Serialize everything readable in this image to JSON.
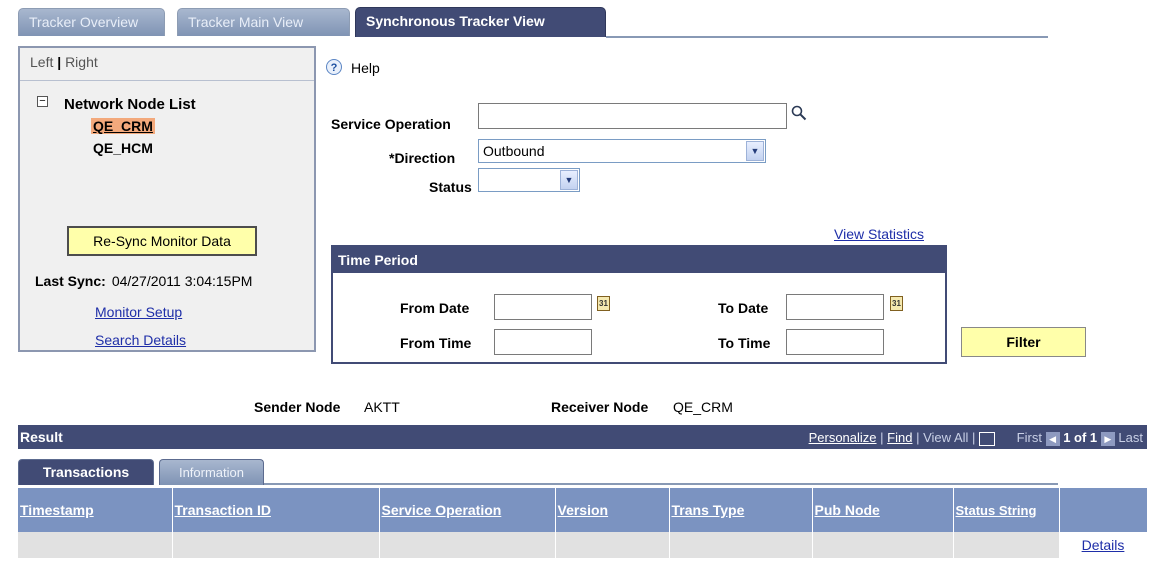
{
  "tabs": [
    "Tracker Overview",
    "Tracker Main View",
    "Synchronous Tracker View"
  ],
  "left_pane": {
    "toggle_left": "Left",
    "toggle_sep": "|",
    "toggle_right": "Right",
    "tree_toggle": "−",
    "tree_title": "Network Node List",
    "nodes": [
      "QE_CRM",
      "QE_HCM"
    ],
    "resync_label": "Re-Sync Monitor Data",
    "last_sync_label": "Last Sync:",
    "last_sync_value": "04/27/2011  3:04:15PM",
    "monitor_setup": "Monitor Setup",
    "search_details": "Search Details"
  },
  "help": {
    "icon_glyph": "?",
    "label": "Help"
  },
  "form": {
    "service_operation_label": "Service Operation",
    "service_operation_value": "",
    "direction_label": "*Direction",
    "direction_value": "Outbound",
    "status_label": "Status",
    "status_value": "",
    "view_statistics": "View Statistics"
  },
  "time_period": {
    "title": "Time Period",
    "from_date_label": "From Date",
    "to_date_label": "To Date",
    "from_time_label": "From Time",
    "to_time_label": "To Time",
    "calendar_glyph": "31"
  },
  "filter_label": "Filter",
  "nodes_info": {
    "sender_label": "Sender Node",
    "sender_value": "AKTT",
    "receiver_label": "Receiver Node",
    "receiver_value": "QE_CRM"
  },
  "result": {
    "title": "Result",
    "personalize": "Personalize",
    "find": "Find",
    "view_all": "View All",
    "first": "First",
    "page_info": "1 of 1",
    "last": "Last",
    "tabs": [
      "Transactions",
      "Information"
    ],
    "columns": [
      "Timestamp",
      "Transaction ID",
      "Service Operation",
      "Version",
      "Trans Type",
      "Pub Node",
      "Status String",
      ""
    ],
    "row_link": "Details"
  },
  "colors": {
    "header_dark": "#414b75",
    "column_header": "#7b93c1",
    "button_yellow": "#ffffaa",
    "link": "#1e2ea8"
  }
}
